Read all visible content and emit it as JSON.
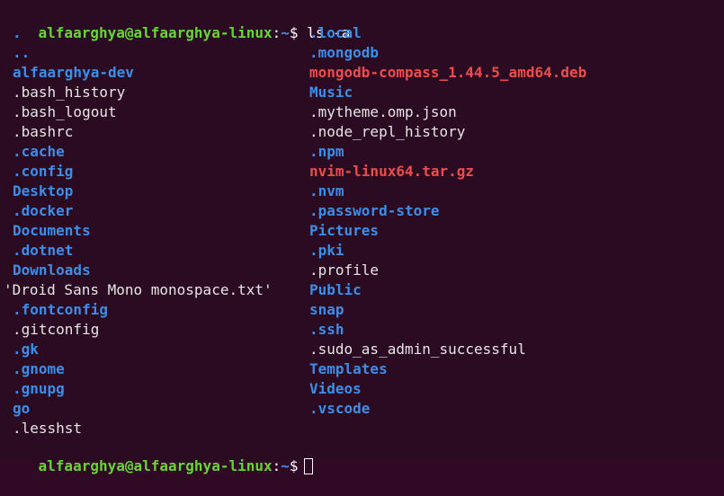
{
  "prompt": {
    "user_host": "alfaarghya@alfaarghya-linux",
    "colon": ":",
    "path": "~",
    "dollar": "$"
  },
  "command": " ls -a",
  "colors": {
    "background": "#2b0b21",
    "prompt_user": "#67d536",
    "directory": "#3b8eea",
    "regular_file": "#e6e6e6",
    "archive": "#f14c4c"
  },
  "listing": {
    "left": [
      {
        "name": ".",
        "type": "dir"
      },
      {
        "name": "..",
        "type": "dir"
      },
      {
        "name": "alfaarghya-dev",
        "type": "dir"
      },
      {
        "name": ".bash_history",
        "type": "file"
      },
      {
        "name": ".bash_logout",
        "type": "file"
      },
      {
        "name": ".bashrc",
        "type": "file"
      },
      {
        "name": ".cache",
        "type": "dir"
      },
      {
        "name": ".config",
        "type": "dir"
      },
      {
        "name": "Desktop",
        "type": "dir"
      },
      {
        "name": ".docker",
        "type": "dir"
      },
      {
        "name": "Documents",
        "type": "dir"
      },
      {
        "name": ".dotnet",
        "type": "dir"
      },
      {
        "name": "Downloads",
        "type": "dir"
      },
      {
        "name": "'Droid Sans Mono monospace.txt'",
        "type": "file"
      },
      {
        "name": ".fontconfig",
        "type": "dir"
      },
      {
        "name": ".gitconfig",
        "type": "file"
      },
      {
        "name": ".gk",
        "type": "dir"
      },
      {
        "name": ".gnome",
        "type": "dir"
      },
      {
        "name": ".gnupg",
        "type": "dir"
      },
      {
        "name": "go",
        "type": "dir"
      },
      {
        "name": ".lesshst",
        "type": "file"
      }
    ],
    "right": [
      {
        "name": ".local",
        "type": "dir"
      },
      {
        "name": ".mongodb",
        "type": "dir"
      },
      {
        "name": "mongodb-compass_1.44.5_amd64.deb",
        "type": "archive"
      },
      {
        "name": "Music",
        "type": "dir"
      },
      {
        "name": ".mytheme.omp.json",
        "type": "file"
      },
      {
        "name": ".node_repl_history",
        "type": "file"
      },
      {
        "name": ".npm",
        "type": "dir"
      },
      {
        "name": "nvim-linux64.tar.gz",
        "type": "archive"
      },
      {
        "name": ".nvm",
        "type": "dir"
      },
      {
        "name": ".password-store",
        "type": "dir"
      },
      {
        "name": "Pictures",
        "type": "dir"
      },
      {
        "name": ".pki",
        "type": "dir"
      },
      {
        "name": ".profile",
        "type": "file"
      },
      {
        "name": "Public",
        "type": "dir"
      },
      {
        "name": "snap",
        "type": "dir"
      },
      {
        "name": ".ssh",
        "type": "dir"
      },
      {
        "name": ".sudo_as_admin_successful",
        "type": "file"
      },
      {
        "name": "Templates",
        "type": "dir"
      },
      {
        "name": "Videos",
        "type": "dir"
      },
      {
        "name": ".vscode",
        "type": "dir"
      }
    ]
  }
}
